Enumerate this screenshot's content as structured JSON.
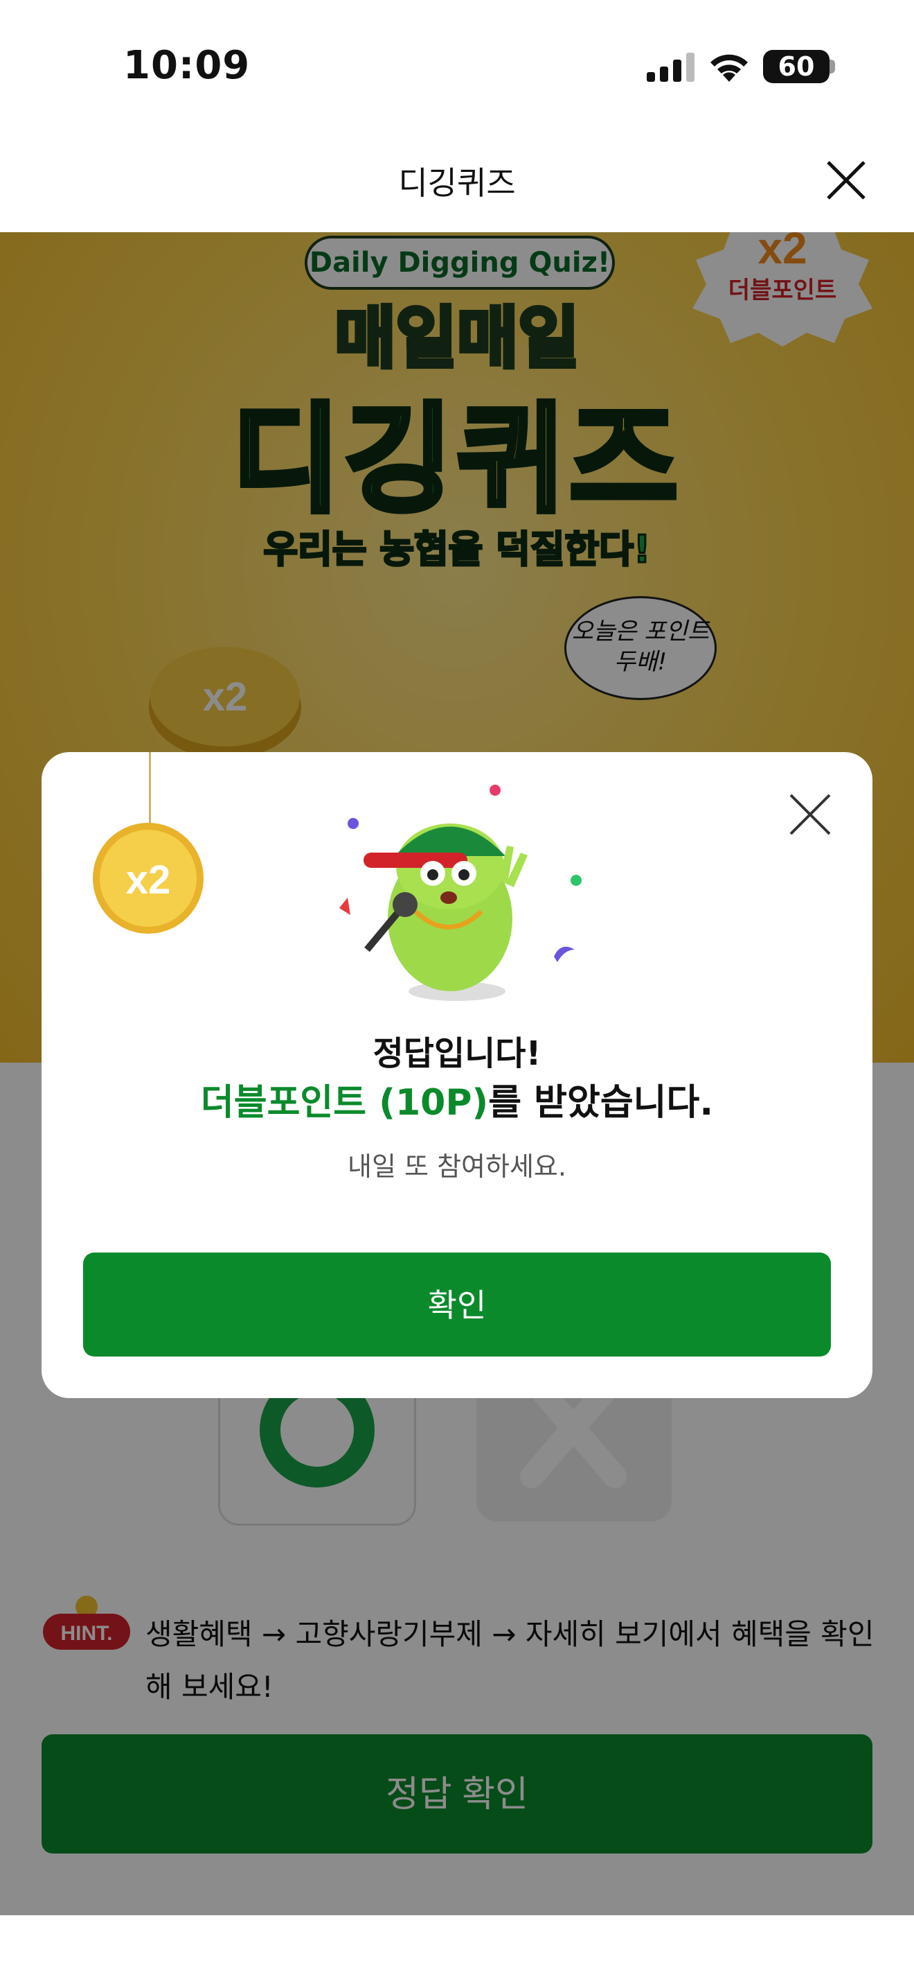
{
  "status_bar": {
    "time": "10:09",
    "battery": "60"
  },
  "header": {
    "title": "디깅퀴즈"
  },
  "banner": {
    "subtitle": "Daily Digging Quiz!",
    "title_line1": "매일매일",
    "title_green": "디깅",
    "title_yellow": "퀴즈",
    "tagline": "우리는 농협을 덕질한다!",
    "badge_multiplier": "x2",
    "badge_label": "더블포인트",
    "speech": "오늘은 포인트 두배!",
    "coin_label": "x2"
  },
  "page": {
    "hint_label": "HINT.",
    "hint_text": "생활혜택 → 고향사랑기부제 → 자세히 보기에서 혜택을 확인해 보세요!",
    "answer_button": "정답 확인"
  },
  "modal": {
    "coin_label": "x2",
    "title": "정답입니다!",
    "highlight": "더블포인트 (10P)",
    "suffix": "를 받았습니다.",
    "sub": "내일 또 참여하세요.",
    "confirm": "확인"
  },
  "colors": {
    "brand_green": "#0b8a2c",
    "banner_yellow": "#f8cf4d"
  }
}
